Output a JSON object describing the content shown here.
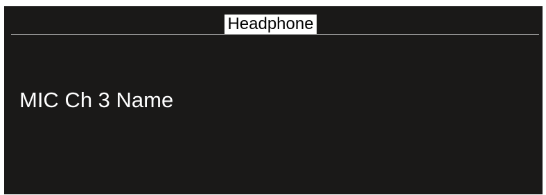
{
  "screen": {
    "title": "Headphone",
    "item_label": "MIC Ch 3 Name"
  }
}
